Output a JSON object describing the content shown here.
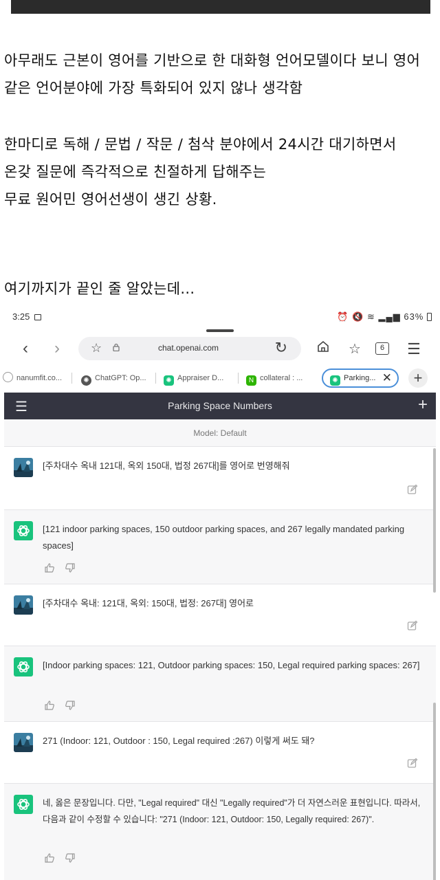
{
  "post": {
    "line1": "아무래도 근본이 영어를 기반으로 한 대화형 언어모델이다 보니 영어",
    "line2": "같은 언어분야에 가장 특화되어 있지 않나 생각함",
    "line3": "한마디로 독해 / 문법 / 작문 / 첨삭 분야에서 24시간 대기하면서",
    "line4": "온갖 질문에 즉각적으로 친절하게 답해주는",
    "line5": "무료 원어민 영어선생이 생긴 상황.",
    "line6": "여기까지가 끝인 줄 알았는데..."
  },
  "status": {
    "time": "3:25",
    "battery": "63%"
  },
  "browser": {
    "url": "chat.openai.com",
    "tab_count": "6",
    "tabs": [
      {
        "label": "nanumfit.co..."
      },
      {
        "label": "ChatGPT: Op..."
      },
      {
        "label": "Appraiser D..."
      },
      {
        "label": "collateral : ..."
      },
      {
        "label": "Parking..."
      }
    ]
  },
  "chat": {
    "title": "Parking Space Numbers",
    "model": "Model: Default",
    "messages": [
      {
        "role": "user",
        "text": "[주차대수 옥내 121대, 옥외 150대, 법정 267대]를 영어로 번영해줘"
      },
      {
        "role": "assistant",
        "text": "[121 indoor parking spaces, 150 outdoor parking spaces, and 267 legally mandated parking spaces]"
      },
      {
        "role": "user",
        "text": "[주차대수 옥내: 121대, 옥외: 150대, 법정: 267대] 영어로"
      },
      {
        "role": "assistant",
        "text": "[Indoor parking spaces: 121, Outdoor parking spaces: 150, Legal required parking spaces: 267]"
      },
      {
        "role": "user",
        "text": "271 (Indoor: 121, Outdoor : 150, Legal required :267) 이렇게 써도 돼?"
      },
      {
        "role": "assistant",
        "text": "네, 옳은 문장입니다. 다만, \"Legal required\" 대신 \"Legally required\"가 더 자연스러운 표현입니다. 따라서, 다음과 같이 수정할 수 있습니다: \"271 (Indoor: 121, Outdoor: 150, Legally required: 267)\"."
      }
    ]
  },
  "colors": {
    "chat_header": "#343541",
    "assistant_avatar": "#19c37d",
    "active_tab_border": "#4a8fd9"
  }
}
